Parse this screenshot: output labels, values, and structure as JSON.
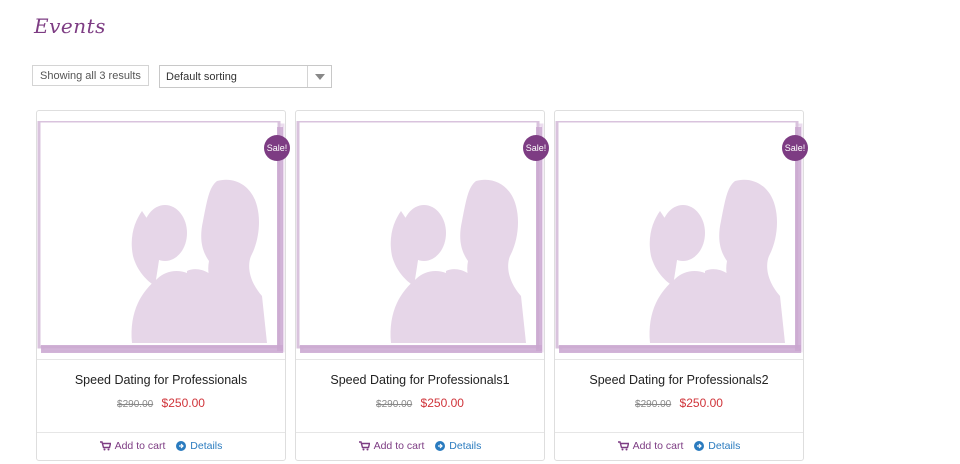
{
  "page": {
    "title": "Events"
  },
  "toolbar": {
    "result_count": "Showing all 3 results",
    "sorting": "Default sorting"
  },
  "products": [
    {
      "title": "Speed Dating for Professionals",
      "old_price": "$290.00",
      "new_price": "$250.00",
      "badge": "Sale!",
      "add_to_cart": "Add to cart",
      "details": "Details"
    },
    {
      "title": "Speed Dating for Professionals1",
      "old_price": "$290.00",
      "new_price": "$250.00",
      "badge": "Sale!",
      "add_to_cart": "Add to cart",
      "details": "Details"
    },
    {
      "title": "Speed Dating for Professionals2",
      "old_price": "$290.00",
      "new_price": "$250.00",
      "badge": "Sale!",
      "add_to_cart": "Add to cart",
      "details": "Details"
    }
  ],
  "colors": {
    "accent": "#7d3c83",
    "sale_price": "#d0343a",
    "link": "#2a7bbf",
    "image_tint": "#e6d6e8"
  }
}
